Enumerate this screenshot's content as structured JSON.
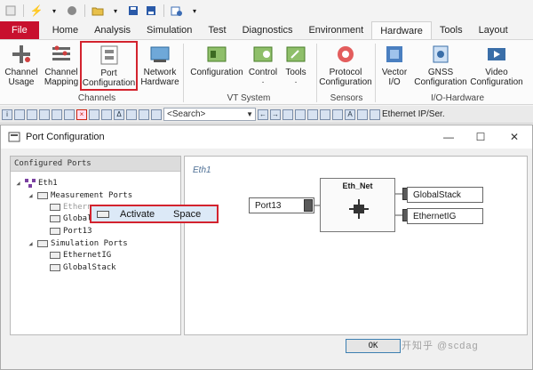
{
  "quick_access": {
    "icons": [
      "bolt-icon",
      "record-icon",
      "folder-icon",
      "save-icon",
      "save-all-icon",
      "config-icon"
    ]
  },
  "ribbon_tabs": [
    {
      "label": "File",
      "kind": "file"
    },
    {
      "label": "Home"
    },
    {
      "label": "Analysis"
    },
    {
      "label": "Simulation"
    },
    {
      "label": "Test"
    },
    {
      "label": "Diagnostics"
    },
    {
      "label": "Environment"
    },
    {
      "label": "Hardware",
      "active": true
    },
    {
      "label": "Tools"
    },
    {
      "label": "Layout"
    }
  ],
  "ribbon": {
    "channel_usage": "Channel\nUsage",
    "channel_mapping": "Channel\nMapping",
    "port_configuration": "Port\nConfiguration",
    "network_hardware": "Network\nHardware",
    "configuration": "Configuration",
    "control": "Control",
    "tools": "Tools",
    "protocol_configuration": "Protocol\nConfiguration",
    "vector_io": "Vector\nI/O",
    "gnss_configuration": "GNSS\nConfiguration",
    "video_configuration": "Video\nConfiguration",
    "groups": {
      "channels": "Channels",
      "vt_system": "VT System",
      "sensors": "Sensors",
      "io_hardware": "I/O-Hardware"
    }
  },
  "toolbar2": {
    "search_placeholder": "<Search>",
    "network_label": "Ethernet IP/Ser."
  },
  "dialog": {
    "title": "Port Configuration",
    "left_header": "Configured Ports",
    "tree": {
      "eth1": "Eth1",
      "measurement_ports": "Measurement Ports",
      "ethernet_partial": "Ethern",
      "global_partial": "Global",
      "port13": "Port13",
      "simulation_ports": "Simulation Ports",
      "ethernetig": "EthernetIG",
      "globalstack": "GlobalStack"
    },
    "canvas_label": "Eth1",
    "node": {
      "title": "Eth_Net"
    },
    "ports": {
      "left": "Port13",
      "right_top": "GlobalStack",
      "right_bottom": "EthernetIG"
    },
    "ok": "OK"
  },
  "context_menu": {
    "item": "Activate",
    "shortcut": "Space"
  },
  "watermark": "开知乎 @scdag",
  "colors": {
    "accent_red": "#d3232e",
    "file_tab": "#c8102e",
    "selection": "#dce9f7"
  }
}
